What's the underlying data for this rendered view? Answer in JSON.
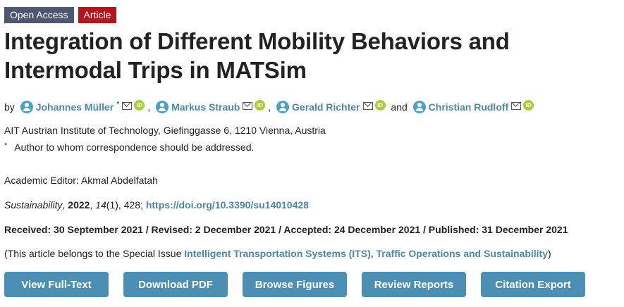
{
  "badges": {
    "open_access": "Open Access",
    "article": "Article"
  },
  "title": "Integration of Different Mobility Behaviors and Intermodal Trips in MATSim",
  "authors": {
    "by": "by",
    "list": [
      {
        "name": "Johannes Müller",
        "star": "*"
      },
      {
        "name": "Markus Straub"
      },
      {
        "name": "Gerald Richter"
      },
      {
        "name": "Christian Rudloff"
      }
    ],
    "comma": ",",
    "and": "and"
  },
  "orcid_label": "iD",
  "affiliation": "AIT Austrian Institute of Technology, Giefinggasse 6, 1210 Vienna, Austria",
  "correspondence": {
    "star": "*",
    "text": "Author to whom correspondence should be addressed."
  },
  "academic_editor": "Academic Editor: Akmal Abdelfatah",
  "citation": {
    "journal": "Sustainability",
    "year": "2022",
    "volume": "14",
    "issue": "(1)",
    "pages": ", 428; ",
    "doi": "https://doi.org/10.3390/su14010428",
    "comma": ", "
  },
  "dates": "Received: 30 September 2021 / Revised: 2 December 2021 / Accepted: 24 December 2021 / Published: 31 December 2021",
  "special_issue": {
    "prefix": "(This article belongs to the Special Issue ",
    "link": "Intelligent Transportation Systems (ITS), Traffic Operations and Sustainability",
    "suffix": ")"
  },
  "buttons": {
    "view_full_text": "View Full-Text",
    "download_pdf": "Download PDF",
    "browse_figures": "Browse Figures",
    "review_reports": "Review Reports",
    "citation_export": "Citation Export"
  },
  "colors": {
    "link": "#4a87a9",
    "button": "#4b8fb5",
    "badge_oa": "#4f5671",
    "badge_article": "#b5131d",
    "orcid": "#a6ce39"
  },
  "icons": [
    "user-icon",
    "mail-icon",
    "orcid-icon"
  ]
}
